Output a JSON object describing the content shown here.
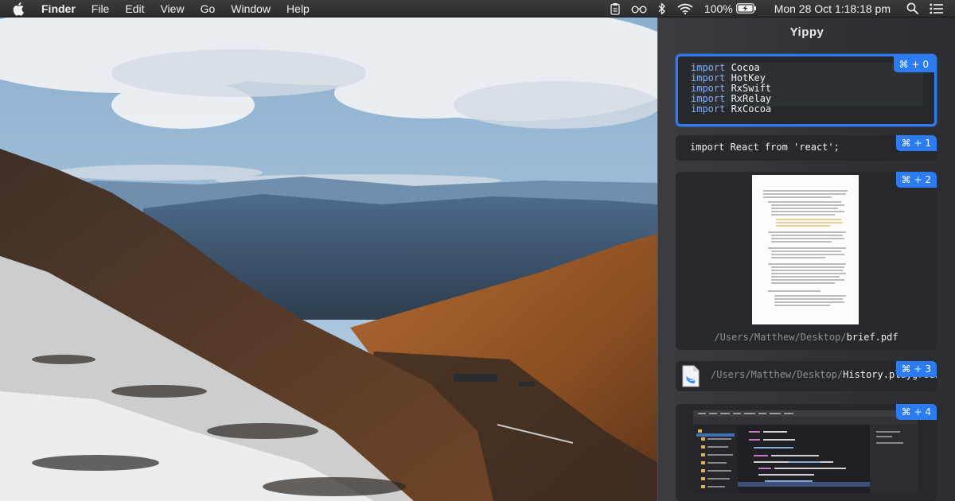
{
  "menubar": {
    "app_name": "Finder",
    "menus": [
      "File",
      "Edit",
      "View",
      "Go",
      "Window",
      "Help"
    ],
    "battery_percent": "100%",
    "datetime": "Mon 28 Oct  1:18:18 pm"
  },
  "panel": {
    "title": "Yippy",
    "accent_color": "#2d7bf0",
    "items": [
      {
        "type": "code",
        "shortcut": "⌘ + 0",
        "selected": true,
        "lines": [
          {
            "keyword": "import",
            "module": " Cocoa"
          },
          {
            "keyword": "import",
            "module": " HotKey"
          },
          {
            "keyword": "import",
            "module": " RxSwift"
          },
          {
            "keyword": "import",
            "module": " RxRelay"
          },
          {
            "keyword": "import",
            "module": " RxCocoa"
          }
        ]
      },
      {
        "type": "text",
        "shortcut": "⌘ + 1",
        "text": "import React from 'react';"
      },
      {
        "type": "file",
        "shortcut": "⌘ + 2",
        "dir": "/Users/Matthew/Desktop/",
        "file": "brief.pdf"
      },
      {
        "type": "file",
        "shortcut": "⌘ + 3",
        "dir": "/Users/Matthew/Desktop/",
        "file": "History.playground"
      },
      {
        "type": "image",
        "shortcut": "⌘ + 4"
      }
    ]
  }
}
